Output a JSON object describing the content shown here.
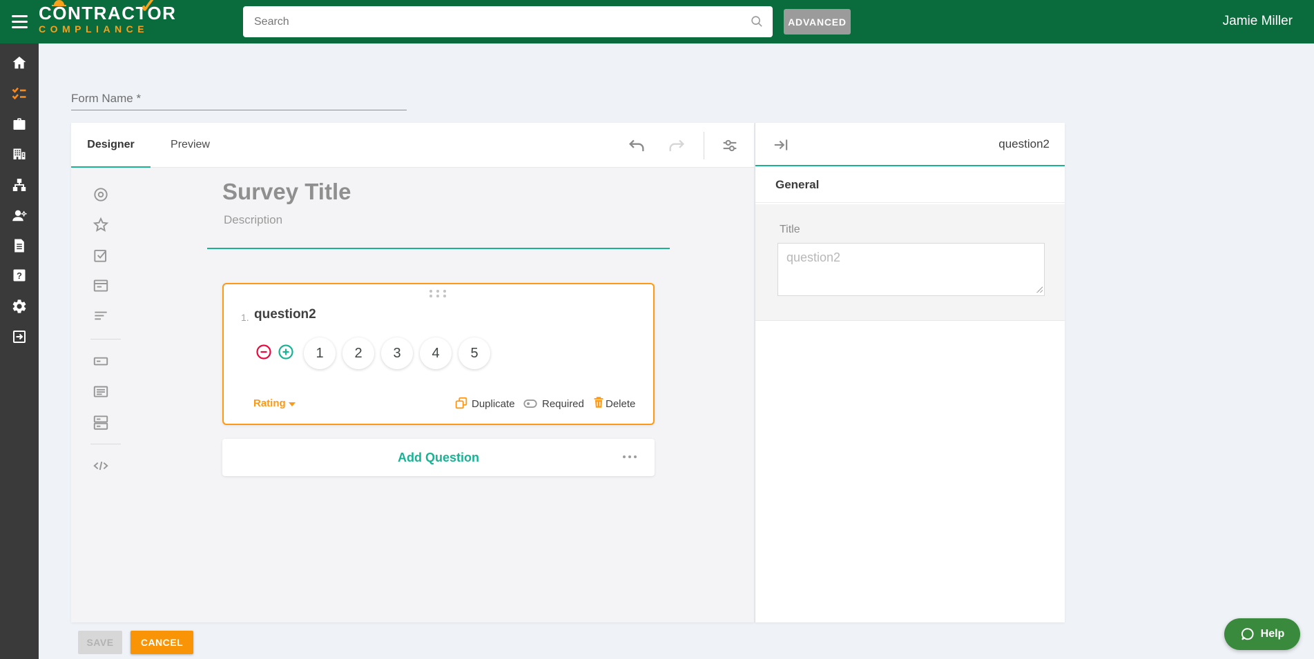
{
  "header": {
    "logo_line1": "CONTRACTOR",
    "logo_line2": "COMPLIANCE",
    "logo_check": "✓",
    "search_placeholder": "Search",
    "advanced_label": "ADVANCED",
    "user_name": "Jamie Miller"
  },
  "sidebar": {
    "items": [
      {
        "icon": "home-icon",
        "active": false
      },
      {
        "icon": "forms-checklist-icon",
        "active": true
      },
      {
        "icon": "briefcase-icon",
        "active": false
      },
      {
        "icon": "company-building-icon",
        "active": false
      },
      {
        "icon": "org-chart-icon",
        "active": false
      },
      {
        "icon": "contractors-worker-icon",
        "active": false
      },
      {
        "icon": "document-icon",
        "active": false
      },
      {
        "icon": "help-question-icon",
        "active": false
      },
      {
        "icon": "settings-gear-icon",
        "active": false
      },
      {
        "icon": "logout-icon",
        "active": false
      }
    ]
  },
  "form": {
    "name_placeholder": "Form Name *"
  },
  "designer": {
    "tabs": [
      {
        "label": "Designer"
      },
      {
        "label": "Preview"
      }
    ],
    "toolbar_icons": [
      "undo-icon",
      "redo-icon",
      "survey-settings-icon"
    ],
    "toolbox": {
      "group1": [
        "radiogroup-icon",
        "rating-star-icon",
        "boolean-check-icon",
        "dropdown-icon",
        "comment-icon"
      ],
      "group2": [
        "text-input-icon",
        "paragraph-icon",
        "multipletext-icon"
      ],
      "group3": [
        "html-code-icon"
      ]
    },
    "survey_title_placeholder": "Survey Title",
    "survey_description_placeholder": "Description",
    "question": {
      "number": "1.",
      "title": "question2",
      "type_label": "Rating",
      "rating": [
        "1",
        "2",
        "3",
        "4",
        "5"
      ],
      "duplicate_label": "Duplicate",
      "required_label": "Required",
      "delete_label": "Delete"
    },
    "add_question_label": "Add Question"
  },
  "properties": {
    "header_title": "question2",
    "section_general": "General",
    "title_label": "Title",
    "title_placeholder": "question2"
  },
  "footer": {
    "save_label": "SAVE",
    "cancel_label": "CANCEL"
  },
  "help_label": "Help",
  "colors": {
    "header_green": "#0a6c3d",
    "sidebar_dark": "#3a3a3a",
    "brand_orange": "#f9a11b",
    "accent_orange": "#ff9814",
    "accent_teal": "#19b394",
    "danger_red": "#e60a3e",
    "page_bg": "#eff3f7"
  }
}
